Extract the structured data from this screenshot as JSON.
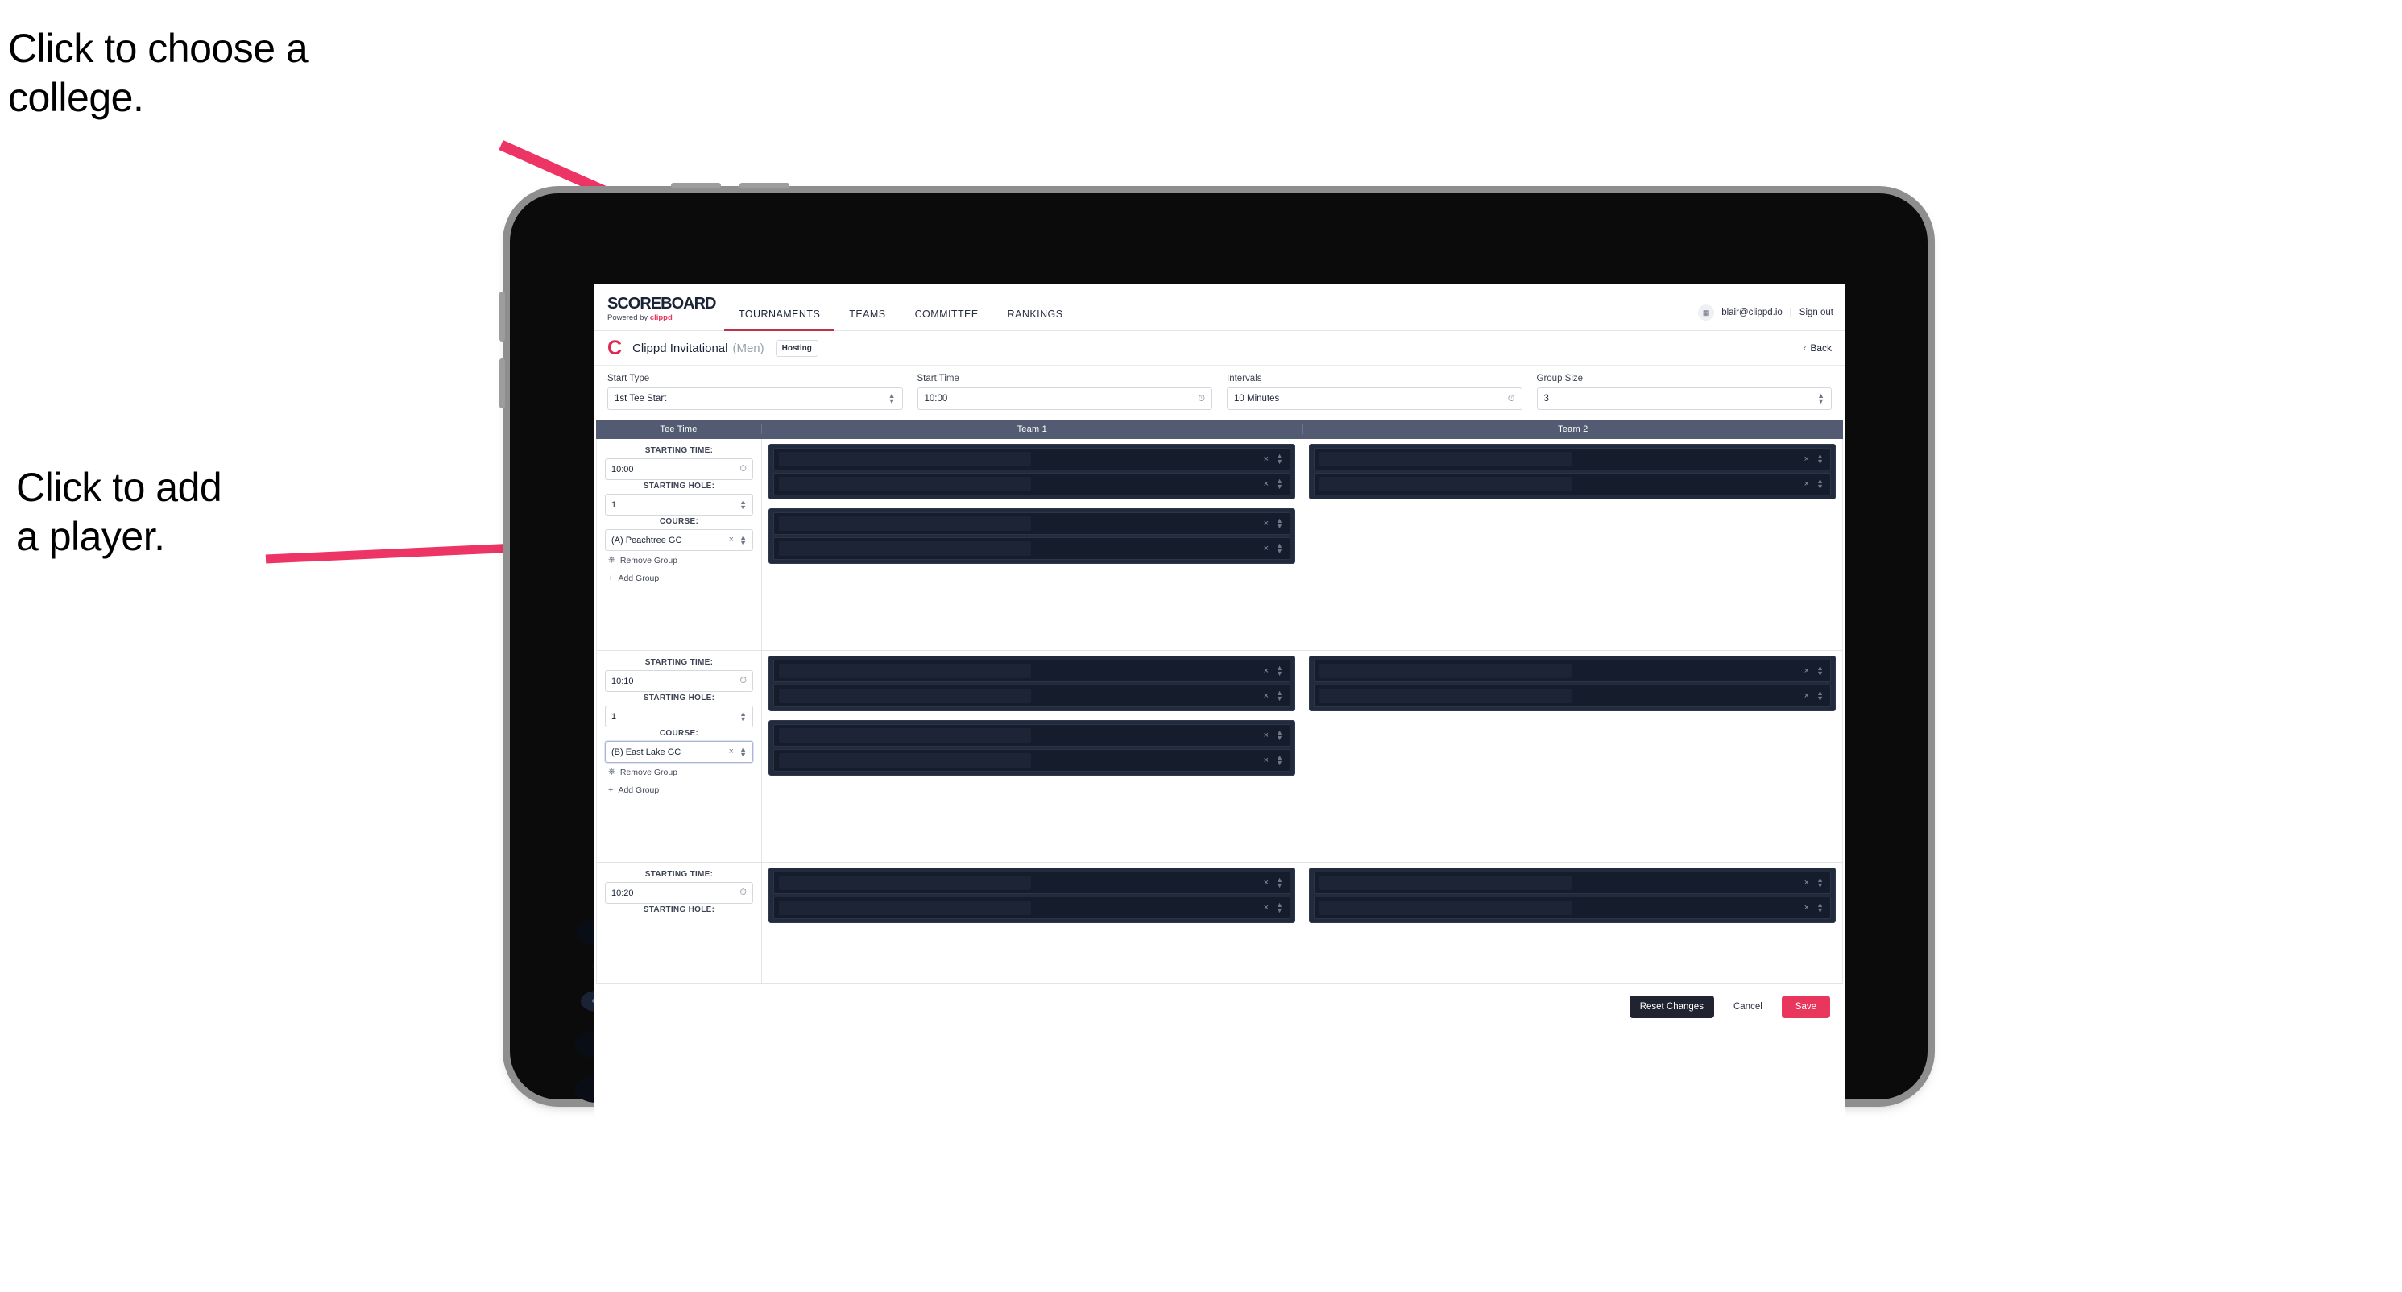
{
  "annotations": {
    "college": "Click to choose a\ncollege.",
    "player": "Click to add\na player."
  },
  "app": {
    "brand": {
      "title": "SCOREBOARD",
      "powered_prefix": "Powered by ",
      "powered_brand": "clippd"
    },
    "nav_tabs": [
      {
        "label": "TOURNAMENTS",
        "active": true
      },
      {
        "label": "TEAMS",
        "active": false
      },
      {
        "label": "COMMITTEE",
        "active": false
      },
      {
        "label": "RANKINGS",
        "active": false
      }
    ],
    "account": {
      "avatar_icon": "user-image-icon",
      "email": "blair@clippd.io",
      "separator": "|",
      "sign_out": "Sign out"
    },
    "title_bar": {
      "logo_letter": "C",
      "tournament": "Clippd Invitational",
      "gender": "(Men)",
      "status_badge": "Hosting",
      "back_label": "Back",
      "back_chevron": "‹"
    },
    "settings": [
      {
        "label": "Start Type",
        "value": "1st Tee Start",
        "icon": "stepper-icon"
      },
      {
        "label": "Start Time",
        "value": "10:00",
        "icon": "clock-icon"
      },
      {
        "label": "Intervals",
        "value": "10 Minutes",
        "icon": "clock-icon"
      },
      {
        "label": "Group Size",
        "value": "3",
        "icon": "stepper-icon"
      }
    ],
    "table": {
      "headers": {
        "tee_time": "Tee Time",
        "team1": "Team 1",
        "team2": "Team 2"
      },
      "captions": {
        "starting_time": "STARTING TIME:",
        "starting_hole": "STARTING HOLE:",
        "course": "COURSE:"
      },
      "links": {
        "remove_group": "Remove Group",
        "add_group": "Add Group",
        "remove_icon": "trash-icon",
        "add_icon": "plus-icon"
      },
      "row_icons": {
        "clear": "×",
        "stepper": "stepper-icon"
      },
      "rows": [
        {
          "starting_time": "10:00",
          "starting_hole": "1",
          "course": "(A) Peachtree GC",
          "course_focused": false,
          "team1_groups": [
            {
              "players": 2
            },
            {
              "players": 2
            }
          ],
          "team2_groups": [
            {
              "players": 2
            }
          ]
        },
        {
          "starting_time": "10:10",
          "starting_hole": "1",
          "course": "(B) East Lake GC",
          "course_focused": true,
          "team1_groups": [
            {
              "players": 2
            },
            {
              "players": 2
            }
          ],
          "team2_groups": [
            {
              "players": 2
            }
          ]
        },
        {
          "starting_time": "10:20",
          "starting_hole": "",
          "course": "",
          "course_focused": false,
          "team1_groups": [
            {
              "players": 2
            }
          ],
          "team2_groups": [
            {
              "players": 2
            }
          ]
        }
      ]
    },
    "footer": {
      "reset": "Reset Changes",
      "cancel": "Cancel",
      "save": "Save"
    }
  },
  "colors": {
    "accent_pink": "#e8365d",
    "header_slate": "#525b72",
    "dark_row": "#151c2b",
    "group_bg": "#222b3c",
    "annotation_arrow": "#ec3465"
  }
}
